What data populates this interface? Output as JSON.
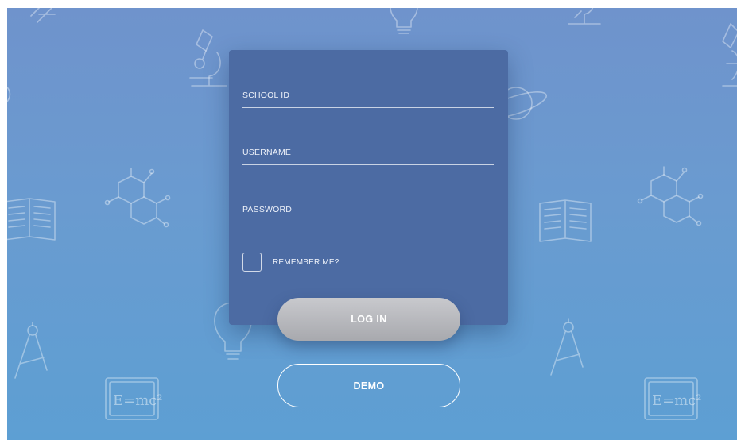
{
  "form": {
    "school_id_label": "SCHOOL ID",
    "username_label": "USERNAME",
    "password_label": "PASSWORD",
    "remember_label": "REMEMBER ME?",
    "remember_checked": false
  },
  "buttons": {
    "login_label": "LOG IN",
    "demo_label": "DEMO"
  },
  "background": {
    "doodle_icons": [
      "microscope-icon",
      "lightbulb-icon",
      "planet-icon",
      "molecule-icon",
      "book-icon",
      "compass-icon",
      "formula-board-icon"
    ],
    "formula_text": "E=mc²"
  },
  "colors": {
    "card": "#4c6ba3",
    "gradient_top": "#6f93cc",
    "gradient_bottom": "#5d9fd3",
    "login_button": "#b8b9be"
  }
}
